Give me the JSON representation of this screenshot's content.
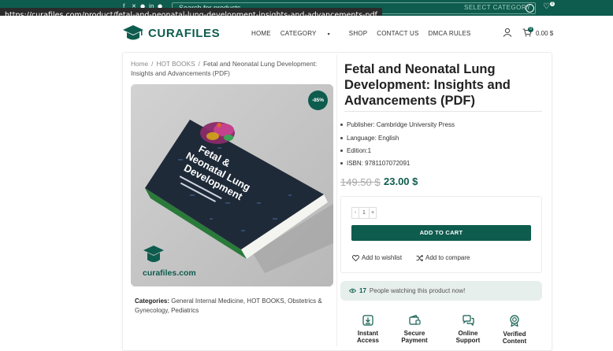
{
  "browser": {
    "status_url": "https://curafiles.com/product/fetal-and-neonatal-lung-development-insights-and-advancements-pdf"
  },
  "topbar": {
    "socials": [
      "facebook-icon",
      "x-icon",
      "pinterest-icon",
      "linkedin-icon",
      "telegram-icon"
    ],
    "search_placeholder": "Search for products",
    "search_category": "SELECT CATEGORY",
    "wishlist_count": "0"
  },
  "header": {
    "logo_text": "CURAFILES",
    "nav": [
      {
        "label": "HOME"
      },
      {
        "label": "CATEGORY"
      },
      {
        "label": "SHOP"
      },
      {
        "label": "CONTACT US"
      },
      {
        "label": "DMCA RULES"
      }
    ],
    "cart_count": "0",
    "cart_total": "0.00 $"
  },
  "breadcrumb": {
    "home": "Home",
    "category": "HOT BOOKS",
    "current": "Fetal and Neonatal Lung Development: Insights and Advancements (PDF)"
  },
  "product": {
    "discount_badge": "-85%",
    "image_watermark": "curafiles.com",
    "book_title_line1": "Fetal &",
    "book_title_line2": "Neonatal Lung",
    "book_title_line3": "Development",
    "title": "Fetal and Neonatal Lung Development: Insights and Advancements (PDF)",
    "meta": [
      "Publisher: Cambridge University Press",
      "Language: English",
      "Edition:1",
      "ISBN: 9781107072091"
    ],
    "price_old": "149.50 $",
    "price_new": "23.00 $",
    "quantity": "1",
    "qty_minus": "-",
    "qty_plus": "+",
    "add_to_cart": "ADD TO CART",
    "add_to_wishlist": "Add to wishlist",
    "add_to_compare": "Add to compare",
    "watching_count": "17",
    "watching_text": "People watching this product now!",
    "categories_label": "Categories:",
    "categories": "General Internal Medicine, HOT BOOKS, Obstetrics & Gynecology, Pediatrics"
  },
  "features": [
    {
      "line1": "Instant",
      "line2": "Access"
    },
    {
      "line1": "Secure",
      "line2": "Payment"
    },
    {
      "line1": "Online",
      "line2": "Support"
    },
    {
      "line1": "Verified",
      "line2": "Content"
    }
  ],
  "colors": {
    "brand": "#0e5c4e",
    "accent_bg": "#e7efec"
  }
}
